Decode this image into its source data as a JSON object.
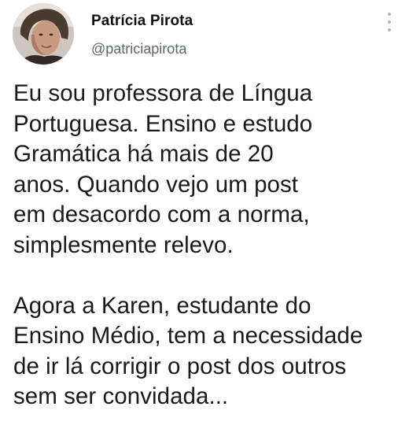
{
  "author": {
    "name": "Patrícia Pirota",
    "handle": "@patriciapirota"
  },
  "icons": {
    "more": "vertical-ellipsis-icon",
    "avatar": "profile-photo"
  },
  "tweet": {
    "paragraph1": [
      "Eu sou professora de Língua",
      "Portuguesa. Ensino e estudo",
      "Gramática há mais de 20",
      "anos. Quando vejo um post",
      "em desacordo com a norma,",
      "simplesmente relevo."
    ],
    "paragraph2": [
      "Agora a Karen, estudante do",
      "Ensino Médio, tem a necessidade",
      "de ir lá corrigir o post dos outros",
      "sem ser convidada..."
    ]
  },
  "colors": {
    "text": "#1a1a1a",
    "handle": "#5b6770",
    "dots": "#b0b6ba"
  }
}
